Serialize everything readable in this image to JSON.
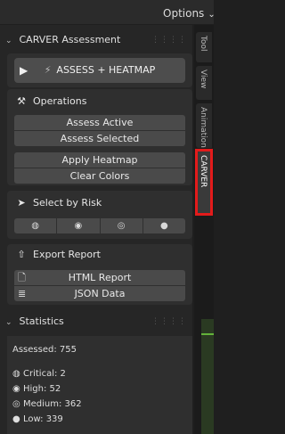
{
  "topbar": {
    "options_label": "Options",
    "options_chevron": "⌄"
  },
  "header": {
    "title": "CARVER Assessment",
    "chevron": "⌄"
  },
  "assess": {
    "label": "ASSESS + HEATMAP",
    "play": "▶",
    "icon": "⚡"
  },
  "operations": {
    "title": "Operations",
    "icon": "⚒",
    "buttons": [
      "Assess Active",
      "Assess Selected",
      "Apply Heatmap",
      "Clear Colors"
    ]
  },
  "select_by_risk": {
    "title": "Select by Risk",
    "icon": "➤",
    "buttons": [
      "◍",
      "◉",
      "◎",
      "●"
    ]
  },
  "export": {
    "title": "Export Report",
    "icon": "⇧",
    "items": [
      {
        "label": "HTML Report",
        "icon": "🗋"
      },
      {
        "label": "JSON Data",
        "icon": "≣"
      }
    ]
  },
  "statistics": {
    "title": "Statistics",
    "chevron": "⌄",
    "assessed": "Assessed: 755",
    "items": [
      {
        "label": "Critical: 2",
        "icon": "◍"
      },
      {
        "label": "High: 52",
        "icon": "◉"
      },
      {
        "label": "Medium: 362",
        "icon": "◎"
      },
      {
        "label": "Low: 339",
        "icon": "●"
      }
    ]
  },
  "tabs": [
    "Tool",
    "View",
    "Animation",
    "CARVER"
  ]
}
